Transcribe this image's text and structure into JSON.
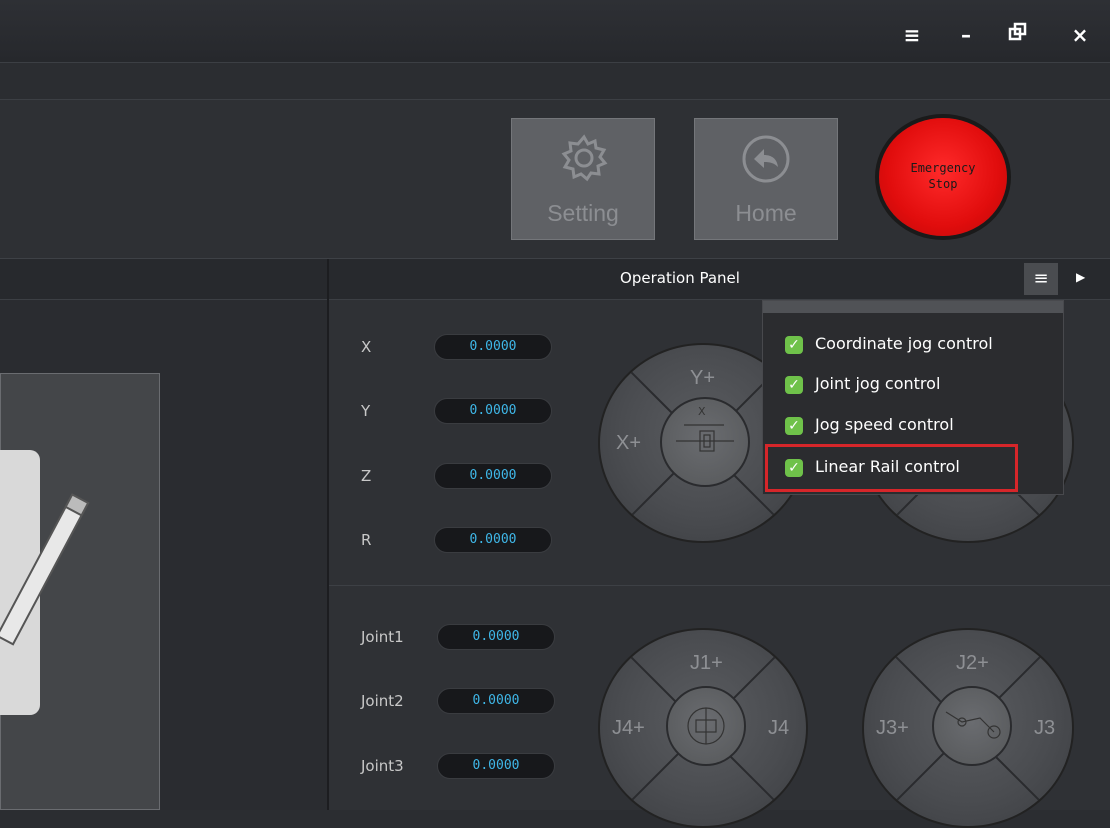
{
  "window": {
    "menu_icon": "hamburger-icon",
    "minimize_icon": "minimize-icon",
    "restore_icon": "restore-icon",
    "close_icon": "close-icon"
  },
  "toolbar": {
    "setting_label": "Setting",
    "home_label": "Home",
    "emergency_label": "Emergency\nStop"
  },
  "operation_panel": {
    "title": "Operation Panel",
    "coordinates": [
      {
        "label": "X",
        "value": "0.0000"
      },
      {
        "label": "Y",
        "value": "0.0000"
      },
      {
        "label": "Z",
        "value": "0.0000"
      },
      {
        "label": "R",
        "value": "0.0000"
      }
    ],
    "joints": [
      {
        "label": "Joint1",
        "value": "0.0000"
      },
      {
        "label": "Joint2",
        "value": "0.0000"
      },
      {
        "label": "Joint3",
        "value": "0.0000"
      }
    ],
    "coord_jog": {
      "up": "Y+",
      "left": "X+",
      "inner_x": "X"
    },
    "joint_jog_1": {
      "up": "J1+",
      "left": "J4+",
      "right": "J4"
    },
    "joint_jog_2": {
      "up": "J2+",
      "left": "J3+",
      "right": "J3"
    }
  },
  "dropdown": {
    "items": [
      {
        "label": "Coordinate jog control",
        "checked": true
      },
      {
        "label": "Joint jog control",
        "checked": true
      },
      {
        "label": "Jog speed control",
        "checked": true
      },
      {
        "label": "Linear Rail control",
        "checked": true
      }
    ],
    "highlighted_item": "Linear Rail control"
  },
  "colors": {
    "accent_value": "#3fb7e8",
    "check_green": "#6fc24a",
    "highlight_red": "#d6262a",
    "estop_red": "#e10d0d"
  }
}
